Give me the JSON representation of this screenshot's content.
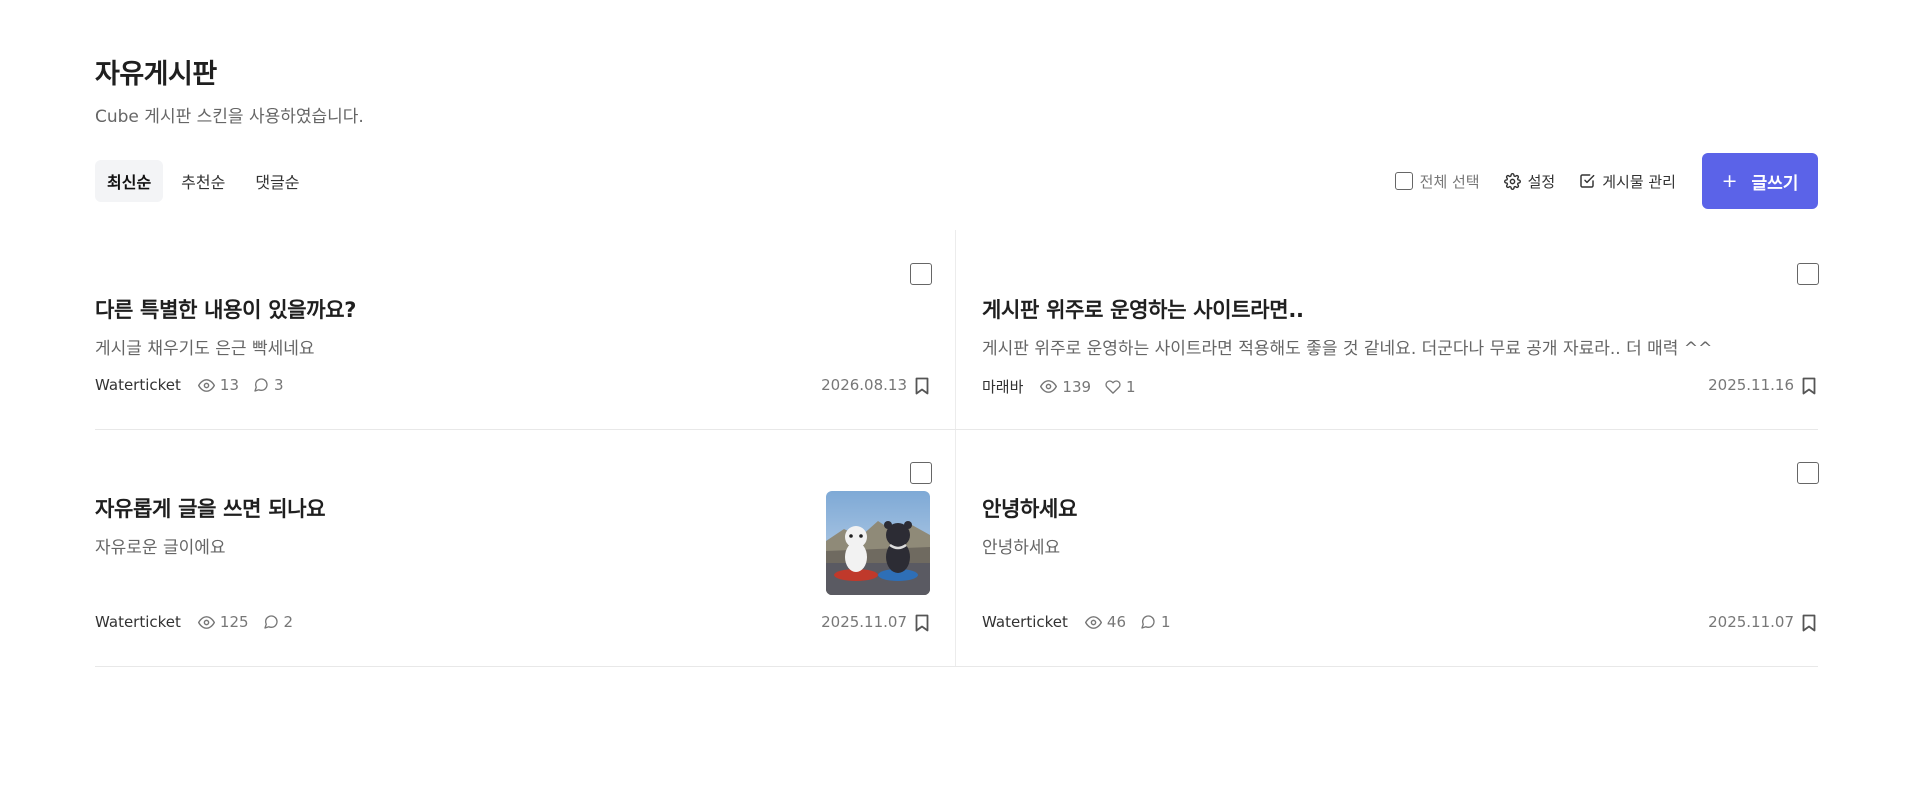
{
  "board": {
    "title": "자유게시판",
    "description": "Cube 게시판 스킨을 사용하였습니다."
  },
  "sort_tabs": [
    {
      "label": "최신순",
      "active": true
    },
    {
      "label": "추천순",
      "active": false
    },
    {
      "label": "댓글순",
      "active": false
    }
  ],
  "tools": {
    "select_all": "전체 선택",
    "settings": "설정",
    "manage": "게시물 관리",
    "write": "글쓰기",
    "write_icon": "+"
  },
  "colors": {
    "accent": "#5b63e8"
  },
  "posts": [
    {
      "title": "다른 특별한 내용이 있을까요?",
      "excerpt": "게시글 채우기도 은근 빡세네요",
      "author": "Waterticket",
      "views": "13",
      "second_stat_icon": "comment-icon",
      "second_stat": "3",
      "date": "2026.08.13",
      "has_thumbnail": false
    },
    {
      "title": "게시판 위주로 운영하는 사이트라면..",
      "excerpt": "게시판 위주로 운영하는 사이트라면 적용해도 좋을 것 같네요. 더군다나 무료 공개 자료라.. 더 매력 ^^",
      "author": "마래바",
      "views": "139",
      "second_stat_icon": "heart-icon",
      "second_stat": "1",
      "date": "2025.11.16",
      "has_thumbnail": false
    },
    {
      "title": "자유롭게 글을 쓰면 되나요",
      "excerpt": "자유로운 글이에요",
      "author": "Waterticket",
      "views": "125",
      "second_stat_icon": "comment-icon",
      "second_stat": "2",
      "date": "2025.11.07",
      "has_thumbnail": true
    },
    {
      "title": "안녕하세요",
      "excerpt": "안녕하세요",
      "author": "Waterticket",
      "views": "46",
      "second_stat_icon": "comment-icon",
      "second_stat": "1",
      "date": "2025.11.07",
      "has_thumbnail": false
    }
  ]
}
